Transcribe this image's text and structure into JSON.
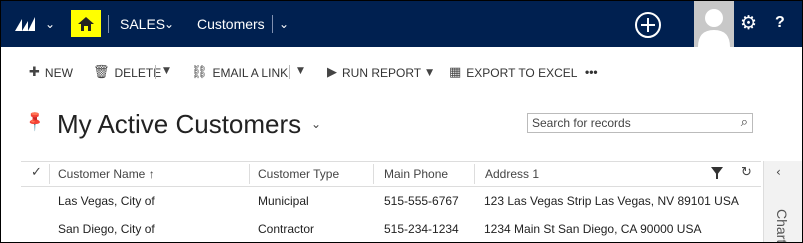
{
  "nav": {
    "area": "SALES",
    "entity": "Customers"
  },
  "commands": {
    "new": "NEW",
    "delete": "DELETE",
    "email_link": "EMAIL A LINK",
    "run_report": "RUN REPORT",
    "export_excel": "EXPORT TO EXCEL",
    "more": "•••"
  },
  "view": {
    "title": "My Active Customers",
    "search_placeholder": "Search for records"
  },
  "grid": {
    "columns": [
      "Customer Name ↑",
      "Customer Type",
      "Main Phone",
      "Address 1"
    ],
    "rows": [
      {
        "name": "Las Vegas, City of",
        "type": "Municipal",
        "phone": "515-555-6767",
        "address": "123 Las Vegas Strip Las Vegas, NV 89101 USA"
      },
      {
        "name": "San Diego, City of",
        "type": "Contractor",
        "phone": "515-234-1234",
        "address": "1234 Main St San Diego, CA 90000 USA"
      }
    ]
  },
  "side_pane": {
    "label": "Charts"
  },
  "colors": {
    "nav_bg": "#002050",
    "home_bg": "#ffff00"
  },
  "icons": [
    "dynamics-logo",
    "home-icon",
    "plus-circle-icon",
    "avatar",
    "gear-icon",
    "help-icon",
    "pin-icon",
    "search-icon",
    "filter-icon",
    "refresh-icon"
  ]
}
